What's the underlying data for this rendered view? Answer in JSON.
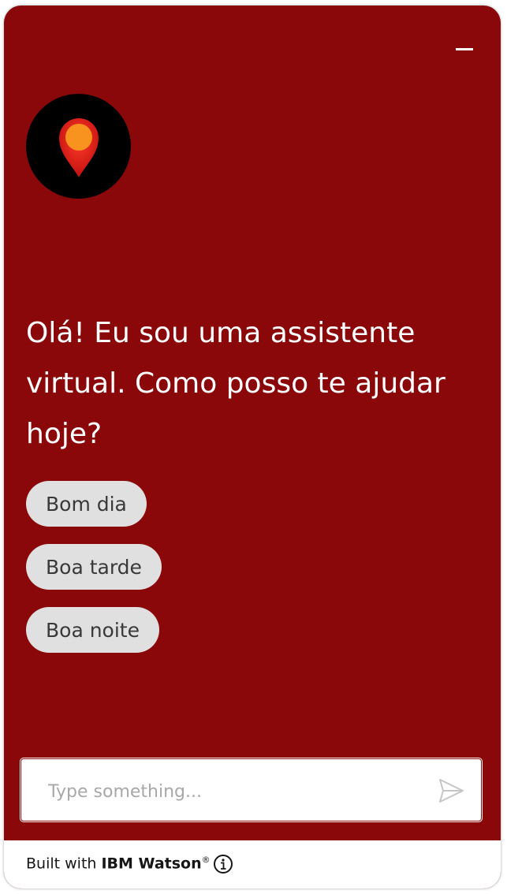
{
  "header": {
    "minimize_icon": "minimize-icon"
  },
  "avatar": {
    "icon": "map-pin-icon"
  },
  "greeting": {
    "text": "Olá! Eu sou uma assistente virtual. Como posso te ajudar hoje?"
  },
  "options": [
    {
      "label": "Bom dia"
    },
    {
      "label": "Boa tarde"
    },
    {
      "label": "Boa noite"
    }
  ],
  "input": {
    "placeholder": "Type something...",
    "value": ""
  },
  "send_icon": "send-icon",
  "footer": {
    "prefix": "Built with ",
    "brand": "IBM Watson",
    "trademark": "®",
    "info_icon": "info-icon"
  },
  "colors": {
    "accent": "#8a0809",
    "chip_bg": "#e0e0e0",
    "chip_text": "#393939",
    "placeholder": "#a8a8a8"
  }
}
